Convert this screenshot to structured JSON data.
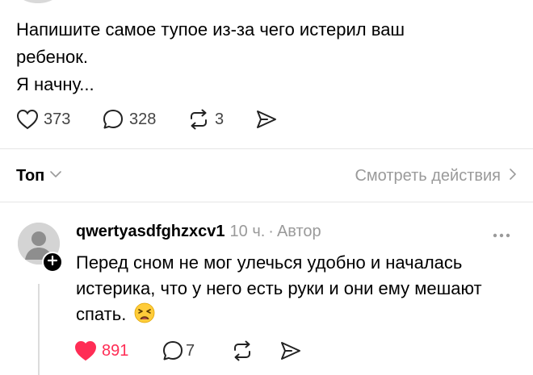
{
  "post": {
    "text_line1": "Напишите самое тупое из-за чего истерил ваш",
    "text_line2": "ребенок.",
    "text_line3": "Я начну...",
    "likes": "373",
    "replies": "328",
    "reposts": "3"
  },
  "sort": {
    "label": "Топ",
    "view_activity": "Смотреть действия"
  },
  "comment": {
    "username": "qwertyasdfghzxcv1",
    "time": "10 ч.",
    "separator": "·",
    "author_tag": "Автор",
    "text": "Перед сном не мог улечься удобно и началась истерика, что у него есть руки и они ему мешают спать.",
    "emoji": "weary-face",
    "likes": "891",
    "replies": "7"
  },
  "colors": {
    "like_active": "#ff2d55",
    "muted_text": "#9a9a9a",
    "divider": "#e6e6e6"
  }
}
